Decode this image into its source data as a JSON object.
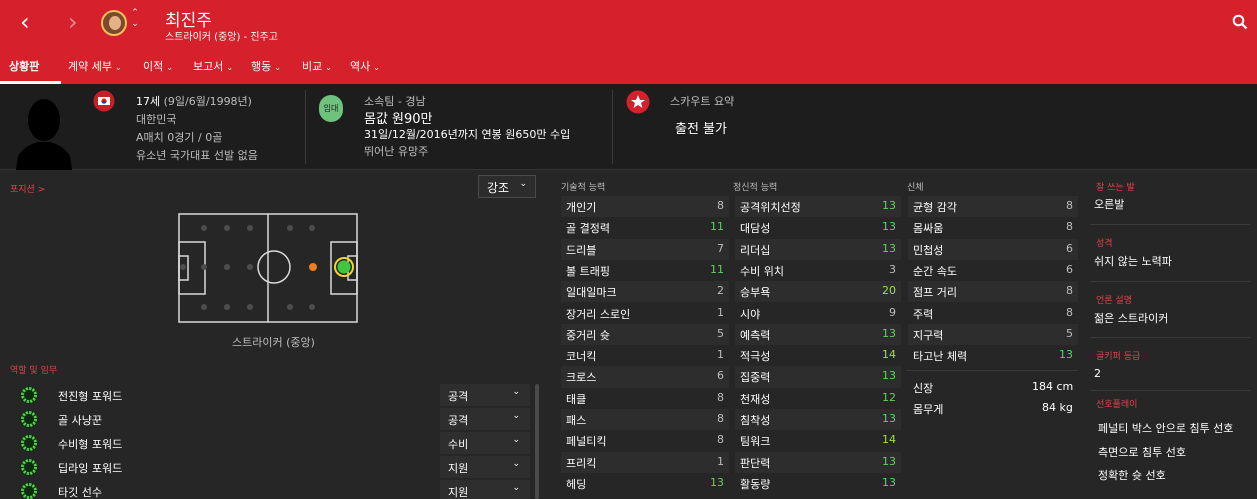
{
  "header": {
    "player_name": "최진주",
    "subtitle": "스트라이커 (중앙) - 진주고",
    "nav_prev": "‹",
    "nav_next": "›",
    "updown": "⌃⌄"
  },
  "tabs": [
    {
      "label": "상황판",
      "active": true
    },
    {
      "label": "계약 세부",
      "active": false
    },
    {
      "label": "이적",
      "active": false
    },
    {
      "label": "보고서",
      "active": false
    },
    {
      "label": "행동",
      "active": false
    },
    {
      "label": "비교",
      "active": false
    },
    {
      "label": "역사",
      "active": false
    }
  ],
  "profile": {
    "age": "17세",
    "dob": "(9일/6월/1998년)",
    "nation": "대한민국",
    "caps": "A매치 0경기 / 0골",
    "youth": "유소년 국가대표 선발 없음"
  },
  "club": {
    "badge": "임대",
    "team_label": "소속팀 - 경남",
    "value": "몸값 원90만",
    "contract": "31일/12월/2016년까지 연봉 원650만 수입",
    "status": "뛰어난 유망주"
  },
  "scout": {
    "title": "스카우트 요약",
    "summary": "출전 불가"
  },
  "position": {
    "heading": "포지션 >",
    "dropdown": "강조",
    "caption": "스트라이커 (중앙)"
  },
  "roles": {
    "heading": "역할 및 임무",
    "items": [
      {
        "name": "전진형 포워드",
        "duty": "공격"
      },
      {
        "name": "골 사냥꾼",
        "duty": "공격"
      },
      {
        "name": "수비형 포워드",
        "duty": "수비"
      },
      {
        "name": "딥라잉 포워드",
        "duty": "지원"
      },
      {
        "name": "타깃 선수",
        "duty": "지원"
      }
    ]
  },
  "attributes": {
    "technical_heading": "기술적 능력",
    "mental_heading": "정신적 능력",
    "physical_heading": "신체",
    "technical": [
      {
        "name": "개인기",
        "value": "8"
      },
      {
        "name": "골 결정력",
        "value": "11"
      },
      {
        "name": "드리블",
        "value": "7"
      },
      {
        "name": "볼 트래핑",
        "value": "11"
      },
      {
        "name": "일대일마크",
        "value": "2"
      },
      {
        "name": "장거리 스로인",
        "value": "1"
      },
      {
        "name": "중거리 슛",
        "value": "5"
      },
      {
        "name": "코너킥",
        "value": "1"
      },
      {
        "name": "크로스",
        "value": "6"
      },
      {
        "name": "태클",
        "value": "8"
      },
      {
        "name": "패스",
        "value": "8"
      },
      {
        "name": "페널티킥",
        "value": "8"
      },
      {
        "name": "프리킥",
        "value": "1"
      },
      {
        "name": "헤딩",
        "value": "13"
      }
    ],
    "mental": [
      {
        "name": "공격위치선정",
        "value": "13"
      },
      {
        "name": "대담성",
        "value": "13"
      },
      {
        "name": "리더십",
        "value": "13"
      },
      {
        "name": "수비 위치",
        "value": "3"
      },
      {
        "name": "승부욕",
        "value": "20"
      },
      {
        "name": "시야",
        "value": "9"
      },
      {
        "name": "예측력",
        "value": "13"
      },
      {
        "name": "적극성",
        "value": "14"
      },
      {
        "name": "집중력",
        "value": "13"
      },
      {
        "name": "천재성",
        "value": "12"
      },
      {
        "name": "침착성",
        "value": "13"
      },
      {
        "name": "팀워크",
        "value": "14"
      },
      {
        "name": "판단력",
        "value": "13"
      },
      {
        "name": "활동량",
        "value": "13"
      }
    ],
    "physical": [
      {
        "name": "균형 감각",
        "value": "8"
      },
      {
        "name": "몸싸움",
        "value": "8"
      },
      {
        "name": "민첩성",
        "value": "6"
      },
      {
        "name": "순간 속도",
        "value": "6"
      },
      {
        "name": "점프 거리",
        "value": "8"
      },
      {
        "name": "주력",
        "value": "8"
      },
      {
        "name": "지구력",
        "value": "5"
      },
      {
        "name": "타고난 체력",
        "value": "13"
      }
    ],
    "height_label": "신장",
    "height": "184 cm",
    "weight_label": "몸무게",
    "weight": "84 kg"
  },
  "sidebar": {
    "foot_label": "잘 쓰는 발",
    "foot": "오른발",
    "personality_label": "성격",
    "personality": "쉬지 않는 노력파",
    "media_label": "언론 설명",
    "media": "젊은 스트라이커",
    "gk_label": "골키퍼 등급",
    "gk": "2",
    "style_label": "선호플레이",
    "styles": [
      "페널티 박스 안으로 침투 선호",
      "측면으로 침투 선호",
      "정확한 슛 선호"
    ]
  },
  "colors": {
    "header_red": "#d6202b",
    "good": "#5fd35a",
    "neutral": "#bdbdbd",
    "accent_red": "#e0434b"
  }
}
